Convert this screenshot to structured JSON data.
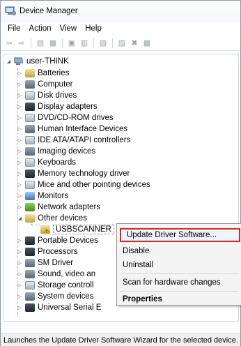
{
  "window": {
    "title": "Device Manager"
  },
  "menu": [
    "File",
    "Action",
    "View",
    "Help"
  ],
  "toolbar": {
    "buttons": [
      "back-arrow-icon",
      "forward-arrow-icon",
      "show-hide-tree-icon",
      "properties-icon",
      "help-icon",
      "view-icon",
      "scan-hardware-icon",
      "update-driver-icon",
      "disable-device-icon",
      "uninstall-device-icon"
    ]
  },
  "tree": {
    "root": "user-THINK",
    "items": [
      {
        "label": "Batteries",
        "icon": "battery-icon"
      },
      {
        "label": "Computer",
        "icon": "computer-icon"
      },
      {
        "label": "Disk drives",
        "icon": "disk-drive-icon"
      },
      {
        "label": "Display adapters",
        "icon": "display-adapter-icon"
      },
      {
        "label": "DVD/CD-ROM drives",
        "icon": "dvd-drive-icon"
      },
      {
        "label": "Human Interface Devices",
        "icon": "hid-icon"
      },
      {
        "label": "IDE ATA/ATAPI controllers",
        "icon": "ide-controller-icon"
      },
      {
        "label": "Imaging devices",
        "icon": "imaging-device-icon"
      },
      {
        "label": "Keyboards",
        "icon": "keyboard-icon"
      },
      {
        "label": "Memory technology driver",
        "icon": "memory-icon"
      },
      {
        "label": "Mice and other pointing devices",
        "icon": "mouse-icon"
      },
      {
        "label": "Monitors",
        "icon": "monitor-icon"
      },
      {
        "label": "Network adapters",
        "icon": "network-adapter-icon"
      },
      {
        "label": "Other devices",
        "icon": "other-devices-icon",
        "expanded": true
      },
      {
        "label": "Portable Devices",
        "icon": "portable-device-icon"
      },
      {
        "label": "Processors",
        "icon": "processor-icon"
      },
      {
        "label": "SM Driver",
        "icon": "sm-driver-icon"
      },
      {
        "label": "Sound, video an",
        "icon": "sound-icon"
      },
      {
        "label": "Storage controll",
        "icon": "storage-controller-icon"
      },
      {
        "label": "System devices",
        "icon": "system-device-icon"
      },
      {
        "label": "Universal Serial E",
        "icon": "usb-icon"
      }
    ],
    "child_of_other_devices": {
      "label": "USBSCANNER",
      "icon": "unknown-device-icon"
    }
  },
  "context_menu": {
    "items": [
      "Update Driver Software...",
      "Disable",
      "Uninstall",
      "Scan for hardware changes",
      "Properties"
    ],
    "highlight_color": "#e0241c"
  },
  "status": "Launches the Update Driver Software Wizard for the selected device."
}
